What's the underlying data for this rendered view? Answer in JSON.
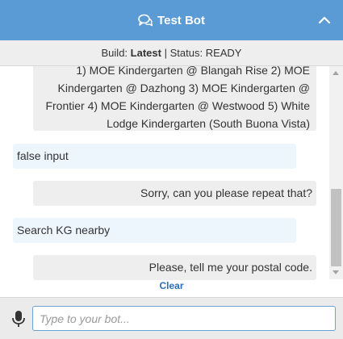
{
  "header": {
    "title": "Test Bot"
  },
  "status": {
    "build_label": "Build:",
    "build_value": "Latest",
    "separator": "|",
    "status_text": "Status: READY"
  },
  "messages": [
    {
      "from": "bot",
      "text": "1) MOE Kindergarten @ Blangah Rise 2) MOE Kindergarten @ Dazhong 3) MOE Kindergarten @ Frontier 4) MOE Kindergarten @ Westwood 5) White Lodge Kindergarten (South Buona Vista)"
    },
    {
      "from": "user",
      "text": "false input"
    },
    {
      "from": "bot",
      "text": "Sorry, can you please repeat that?"
    },
    {
      "from": "user",
      "text": "Search KG nearby"
    },
    {
      "from": "bot",
      "text": "Please, tell me your postal code."
    }
  ],
  "clear_label": "Clear",
  "input": {
    "placeholder": "Type to your bot...",
    "value": ""
  },
  "colors": {
    "header": "#5b9bd5",
    "link": "#2a6ebb",
    "bot_bubble": "#eeeeee",
    "user_bubble": "#eef6fd"
  }
}
